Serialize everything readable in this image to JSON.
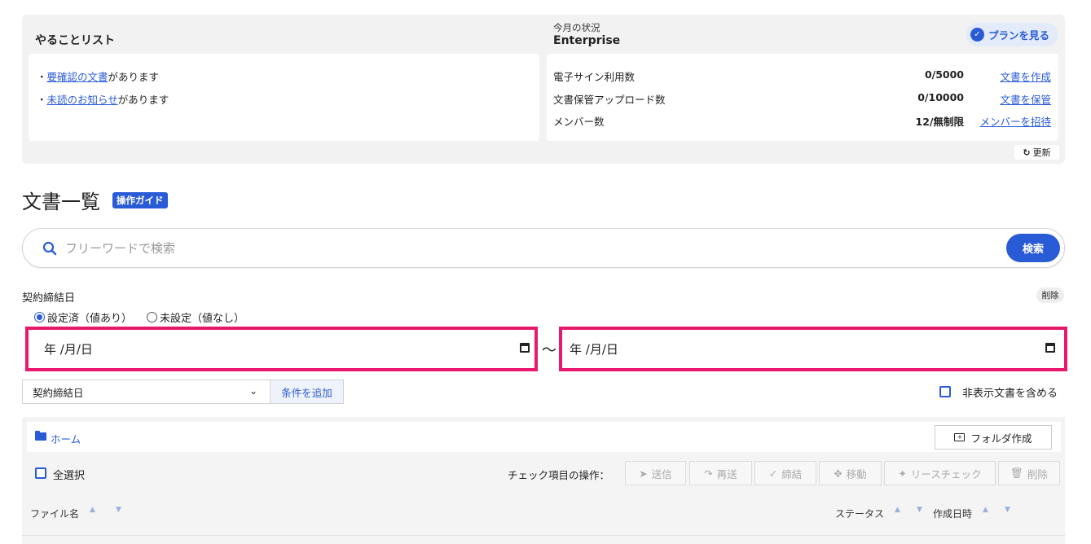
{
  "todo": {
    "title": "やることリスト",
    "item1_prefix": "・",
    "item1_link": "要確認の文書",
    "item1_suffix": "があります",
    "item2_prefix": "・",
    "item2_link": "未読のお知らせ",
    "item2_suffix": "があります"
  },
  "plan": {
    "caption": "今月の状況",
    "name": "Enterprise",
    "view_plan_label": "プランを見る",
    "rows": [
      {
        "label": "電子サイン利用数",
        "value": "0/5000",
        "link": "文書を作成"
      },
      {
        "label": "文書保管アップロード数",
        "value": "0/10000",
        "link": "文書を保管"
      },
      {
        "label": "メンバー数",
        "value": "12/無制限",
        "link": "メンバーを招待"
      }
    ],
    "refresh_label": "更新"
  },
  "page": {
    "title": "文書一覧",
    "guide_label": "操作ガイド"
  },
  "search": {
    "placeholder": "フリーワードで検索",
    "button_label": "検索"
  },
  "filter": {
    "label": "契約締結日",
    "delete_label": "削除",
    "radio_set_label": "設定済（値あり）",
    "radio_unset_label": "未設定（値なし）",
    "date_from": "年 /月/日",
    "date_separator": "～",
    "date_to": "年 /月/日",
    "condition_select": "契約締結日",
    "add_condition_label": "条件を追加",
    "include_hidden_label": "非表示文書を含める"
  },
  "files": {
    "home_label": "ホーム",
    "new_folder_label": "フォルダ作成",
    "select_all_label": "全選択",
    "ops_label": "チェック項目の操作：",
    "ops": [
      "送信",
      "再送",
      "締結",
      "移動",
      "リースチェック",
      "削除"
    ],
    "columns": {
      "name": "ファイル名",
      "status": "ステータス",
      "created": "作成日時"
    }
  },
  "colors": {
    "accent": "#2a5bd7",
    "highlight": "#e8186c"
  }
}
